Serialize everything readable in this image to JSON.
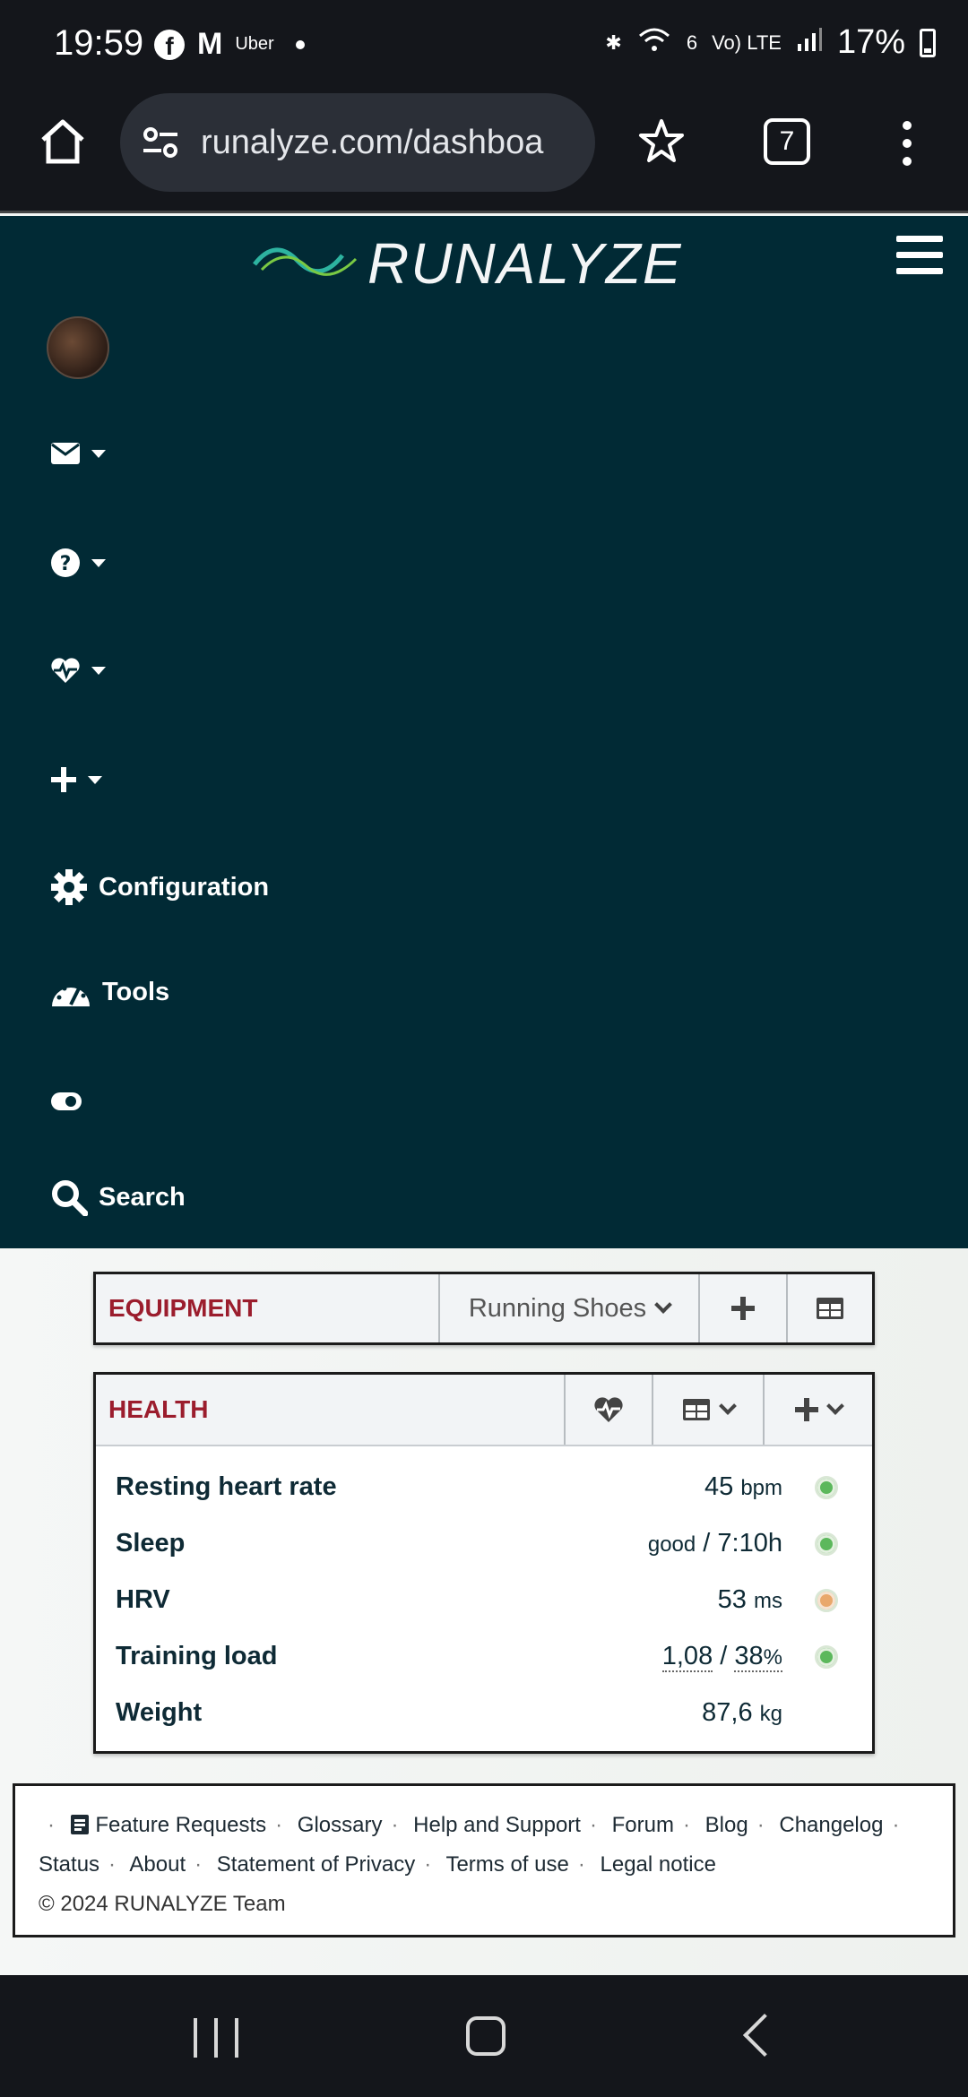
{
  "status_bar": {
    "time": "19:59",
    "notif_uber": "Uber",
    "network": "Vo) LTE",
    "signal_6": "6",
    "battery": "17%"
  },
  "browser": {
    "url": "runalyze.com/dashboa",
    "tab_count": "7"
  },
  "brand": {
    "logo_text": "RUNALYZE"
  },
  "nav": {
    "configuration": "Configuration",
    "tools": "Tools",
    "search": "Search"
  },
  "equipment": {
    "title": "EQUIPMENT",
    "selected": "Running Shoes",
    "add": "+"
  },
  "health": {
    "title": "HEALTH",
    "rows": [
      {
        "label": "Resting heart rate",
        "value": "45",
        "unit": "bpm",
        "status": "green"
      },
      {
        "label": "Sleep",
        "quality": "good",
        "sep": "/",
        "value": "7:10h",
        "status": "green"
      },
      {
        "label": "HRV",
        "value": "53",
        "unit": "ms",
        "status": "orange"
      },
      {
        "label": "Training load",
        "value1": "1,08",
        "sep": "/",
        "value2": "38",
        "unit2": "%",
        "status": "green"
      },
      {
        "label": "Weight",
        "value": "87,6",
        "unit": "kg"
      }
    ]
  },
  "footer": {
    "links": [
      "Feature Requests",
      "Glossary",
      "Help and Support",
      "Forum",
      "Blog",
      "Changelog",
      "Status",
      "About",
      "Statement of Privacy",
      "Terms of use",
      "Legal notice"
    ],
    "copyright": "© 2024 RUNALYZE Team"
  },
  "colors": {
    "nav_bg": "#012a35",
    "panel_title": "#9b1d2d",
    "status_green": "#5cb85c",
    "status_orange": "#e9a86c"
  }
}
